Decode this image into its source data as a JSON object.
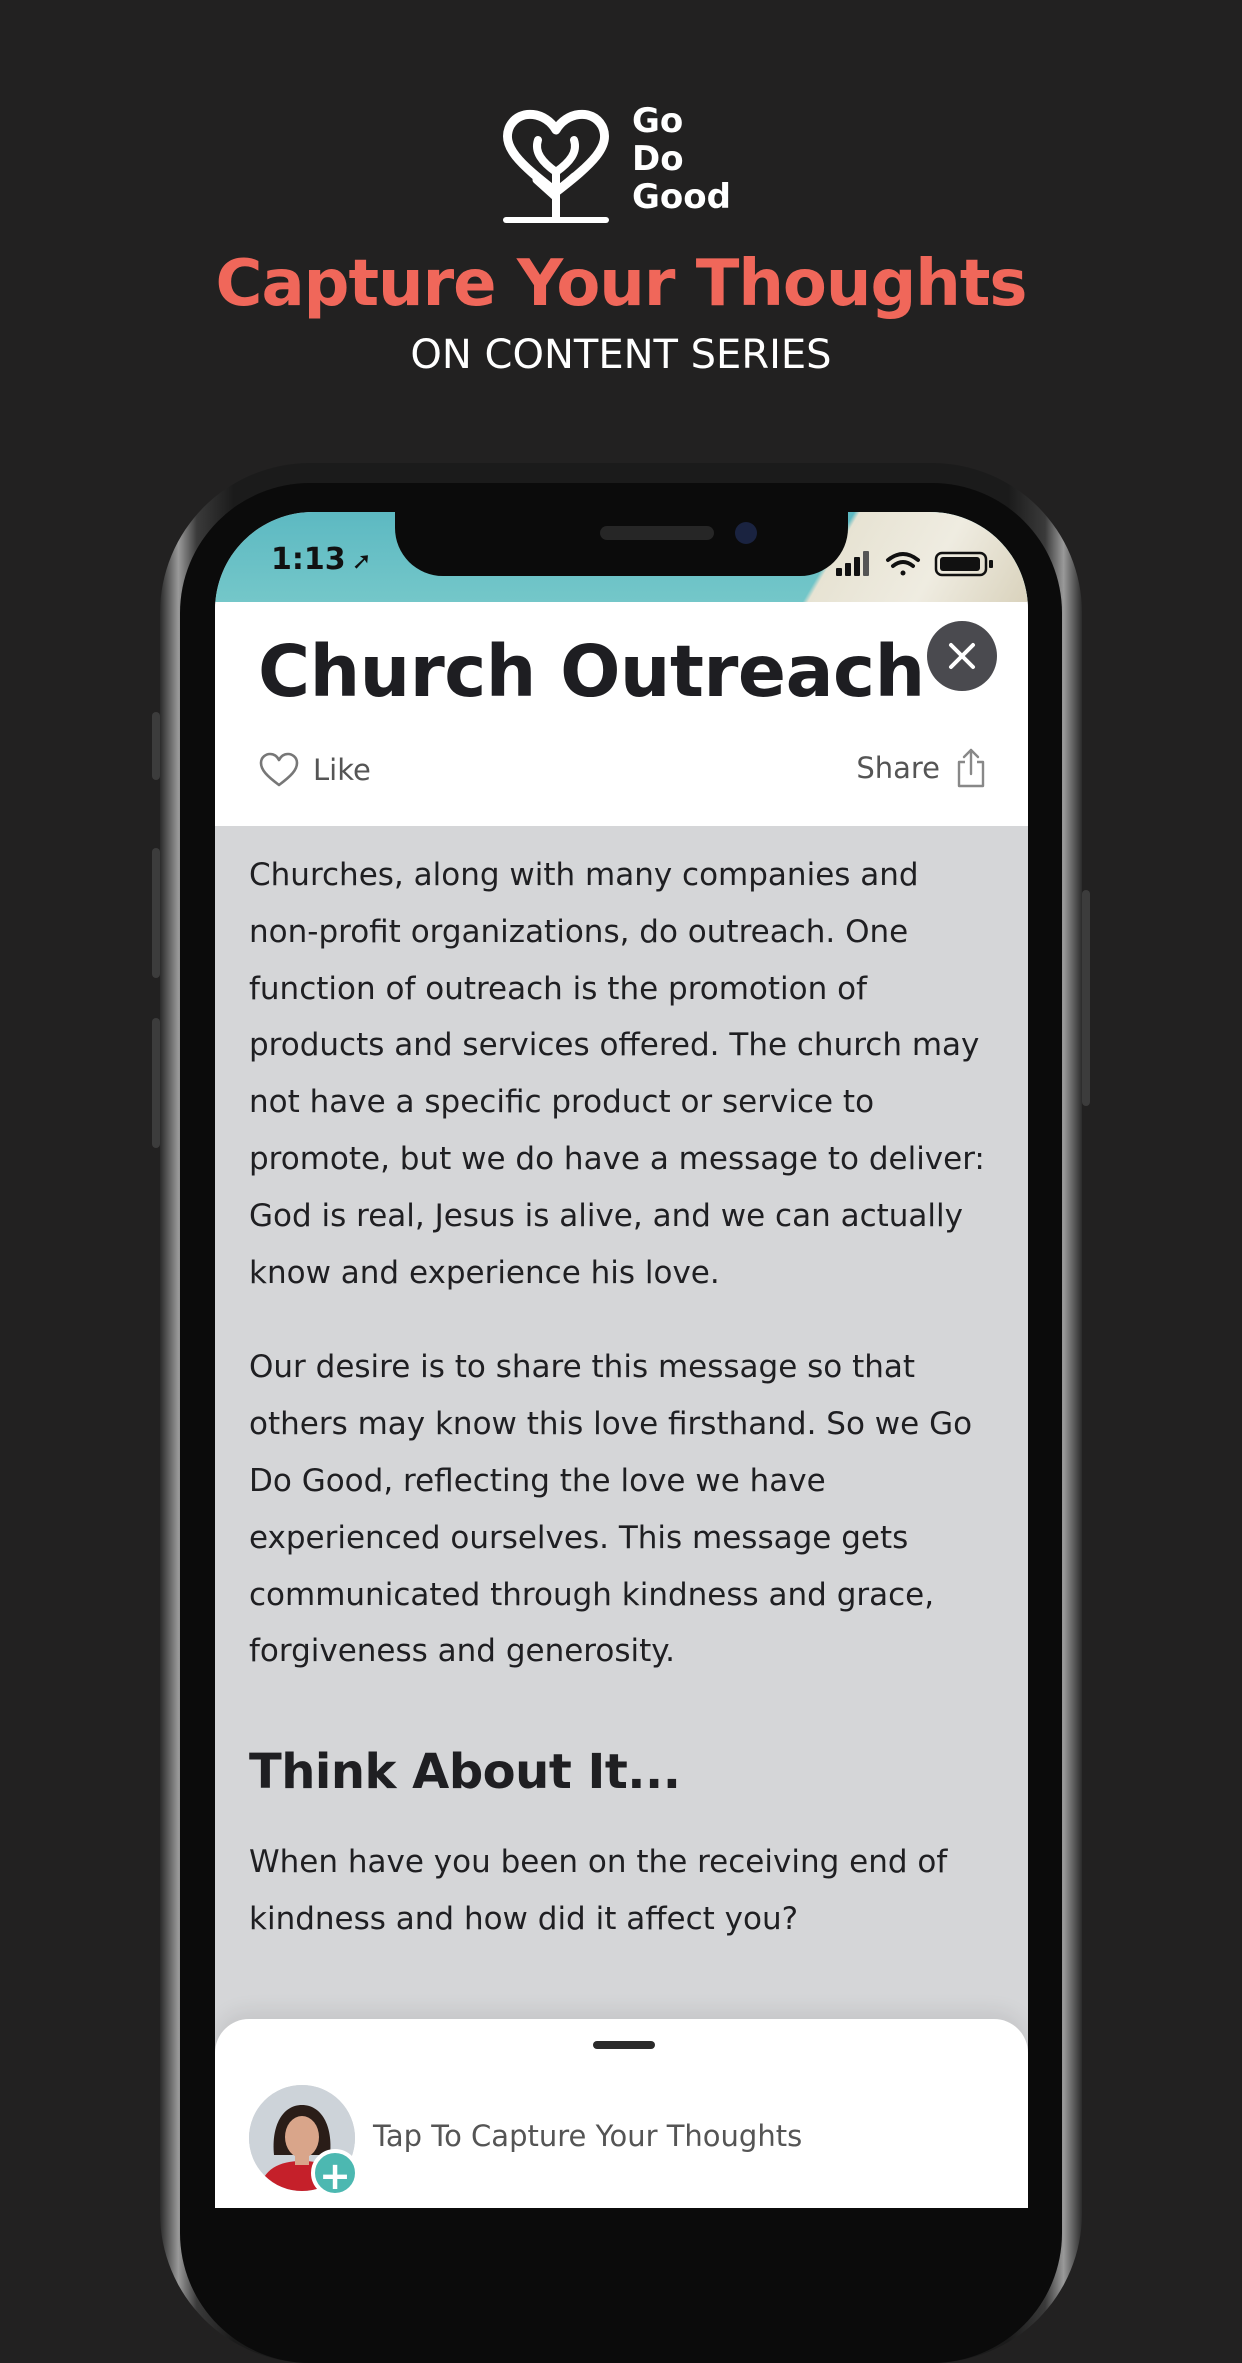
{
  "brand": {
    "line1": "Go",
    "line2": "Do",
    "line3": "Good"
  },
  "promo": {
    "headline": "Capture Your Thoughts",
    "subhead": "ON CONTENT SERIES"
  },
  "status_bar": {
    "time": "1:13",
    "location_icon": "location-arrow-icon",
    "icons": [
      "cellular-signal-icon",
      "wifi-icon",
      "battery-icon"
    ]
  },
  "article": {
    "title": "Church Outreach",
    "like_label": "Like",
    "share_label": "Share",
    "paragraphs": [
      "Churches, along with many companies and non-profit organizations, do outreach. One function of outreach is the promotion of products and services offered. The church may not have a specific product or service to promote, but we do have a message to deliver: God is real, Jesus is alive, and we can actually know and experience his love.",
      "Our desire is to share this message so that others may know this love firsthand. So we Go Do Good, reflecting the love we have experienced ourselves. This message gets communicated through kindness and grace, forgiveness and generosity."
    ],
    "section_heading": "Think About It...",
    "question": "When have you been on the receiving end of kindness and how did it affect you?"
  },
  "drawer": {
    "capture_label": "Tap To Capture Your Thoughts"
  },
  "colors": {
    "accent_coral": "#f0675a",
    "background": "#222121",
    "content_bg": "#d5d6d8",
    "add_teal": "#4cb8b1"
  }
}
